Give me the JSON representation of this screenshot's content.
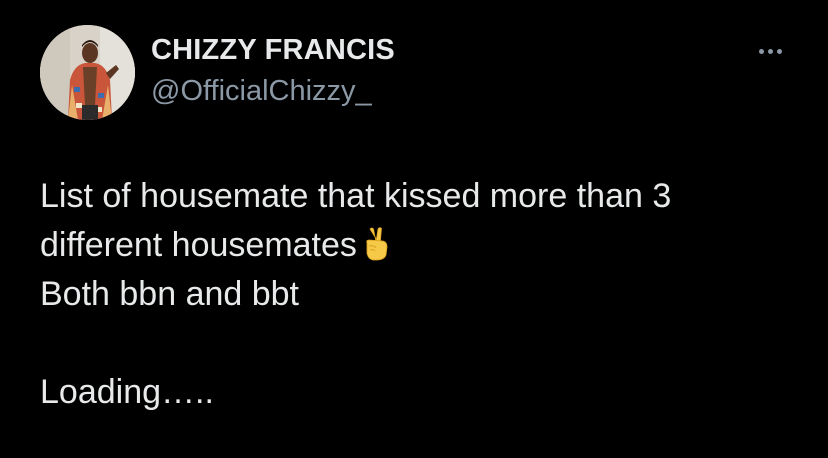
{
  "author": {
    "display_name": "CHIZZY FRANCIS",
    "handle": "@OfficialChizzy_"
  },
  "tweet": {
    "line1": "List of housemate that kissed more than 3",
    "line2": "different housemates",
    "line2_emoji": "victory-hand-icon",
    "line3": "Both bbn and bbt",
    "line5": "Loading….."
  },
  "icons": {
    "more": "more-horizontal-icon",
    "avatar": "profile-photo"
  },
  "colors": {
    "background": "#000000",
    "primary_text": "#e7e9ea",
    "secondary_text": "#8b98a5"
  }
}
